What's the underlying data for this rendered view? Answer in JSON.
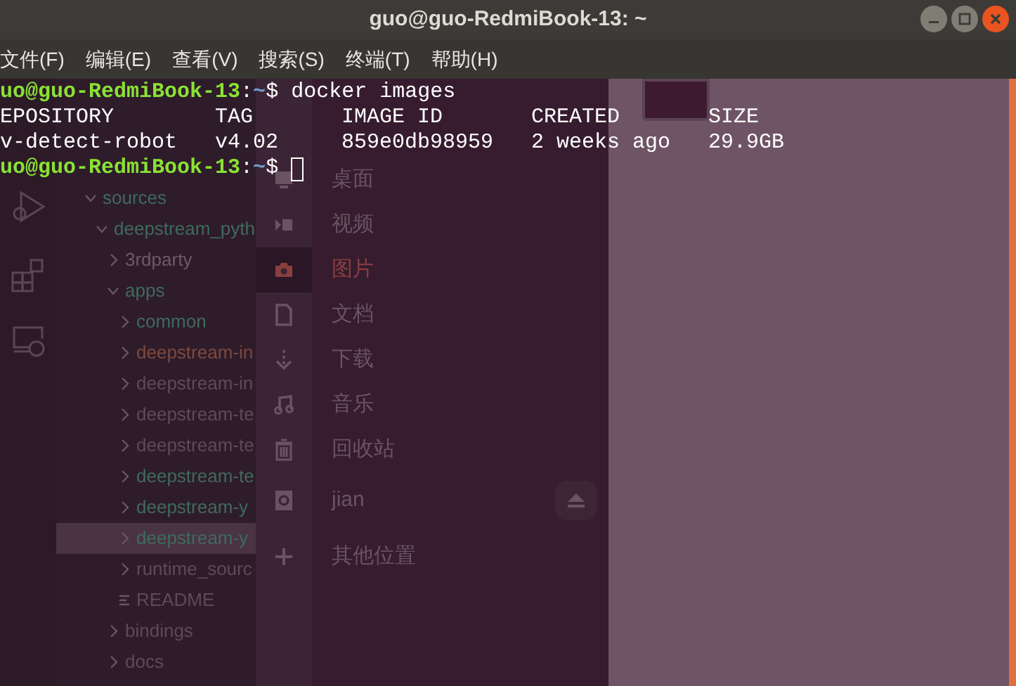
{
  "window": {
    "title": "guo@guo-RedmiBook-13: ~"
  },
  "menu": [
    "文件(F)",
    "编辑(E)",
    "查看(V)",
    "搜索(S)",
    "终端(T)",
    "帮助(H)"
  ],
  "terminal": {
    "lines": [
      {
        "kind": "prompt",
        "user": "uo@guo-RedmiBook-13",
        "sep": ":",
        "path": "~",
        "symbol": "$",
        "command": "docker images"
      },
      {
        "kind": "table",
        "cells": [
          "EPOSITORY",
          "TAG",
          "IMAGE ID",
          "CREATED",
          "SIZE"
        ]
      },
      {
        "kind": "table",
        "cells": [
          "v-detect-robot",
          "v4.02",
          "859e0db98959",
          "2 weeks ago",
          "29.9GB"
        ]
      },
      {
        "kind": "prompt",
        "user": "uo@guo-RedmiBook-13",
        "sep": ":",
        "path": "~",
        "symbol": "$",
        "cursor": true
      }
    ]
  },
  "editor_tree": [
    {
      "label": "sources",
      "kind": "folder",
      "expanded": true,
      "color": "#3f6b5c",
      "selected": false,
      "children": [
        {
          "label": "deepstream_pyth",
          "kind": "folder",
          "expanded": true,
          "color": "#3f6b5c",
          "selected": false,
          "children": [
            {
              "label": "3rdparty",
              "kind": "folder",
              "expanded": false,
              "color": "#6e5a68",
              "selected": false
            },
            {
              "label": "apps",
              "kind": "folder",
              "expanded": true,
              "color": "#3f6b5c",
              "selected": false,
              "children": [
                {
                  "label": "common",
                  "kind": "folder",
                  "expanded": false,
                  "color": "#3f6b5c",
                  "selected": false
                },
                {
                  "label": "deepstream-in",
                  "kind": "folder",
                  "expanded": false,
                  "color": "#7e4a3e",
                  "selected": false
                },
                {
                  "label": "deepstream-in",
                  "kind": "folder",
                  "expanded": false,
                  "color": "#5e4a5a",
                  "selected": false
                },
                {
                  "label": "deepstream-te",
                  "kind": "folder",
                  "expanded": false,
                  "color": "#5e4a5a",
                  "selected": false
                },
                {
                  "label": "deepstream-te",
                  "kind": "folder",
                  "expanded": false,
                  "color": "#5e4a5a",
                  "selected": false
                },
                {
                  "label": "deepstream-te",
                  "kind": "folder",
                  "expanded": false,
                  "color": "#3f6b5c",
                  "selected": false
                },
                {
                  "label": "deepstream-y",
                  "kind": "folder",
                  "expanded": false,
                  "color": "#3f6b5c",
                  "selected": false
                },
                {
                  "label": "deepstream-y",
                  "kind": "folder",
                  "expanded": false,
                  "color": "#3f6b5c",
                  "selected": true
                },
                {
                  "label": "runtime_sourc",
                  "kind": "folder",
                  "expanded": false,
                  "color": "#5e4a5a",
                  "selected": false
                },
                {
                  "label": "README",
                  "kind": "file",
                  "color": "#5e4a5a",
                  "selected": false
                }
              ]
            },
            {
              "label": "bindings",
              "kind": "folder",
              "expanded": false,
              "color": "#5e4a5a",
              "selected": false
            },
            {
              "label": "docs",
              "kind": "folder",
              "expanded": false,
              "color": "#5e4a5a",
              "selected": false
            }
          ]
        }
      ]
    }
  ],
  "places": [
    {
      "label": "桌面",
      "kind": "desktop",
      "selected": false
    },
    {
      "label": "视频",
      "kind": "video",
      "selected": false
    },
    {
      "label": "图片",
      "kind": "camera",
      "selected": true
    },
    {
      "label": "文档",
      "kind": "document",
      "selected": false
    },
    {
      "label": "下载",
      "kind": "download",
      "selected": false
    },
    {
      "label": "音乐",
      "kind": "music",
      "selected": false
    },
    {
      "label": "回收站",
      "kind": "trash",
      "selected": false
    },
    {
      "label": "jian",
      "kind": "drive",
      "selected": false,
      "eject": true
    },
    {
      "label": "其他位置",
      "kind": "add",
      "selected": false
    }
  ]
}
